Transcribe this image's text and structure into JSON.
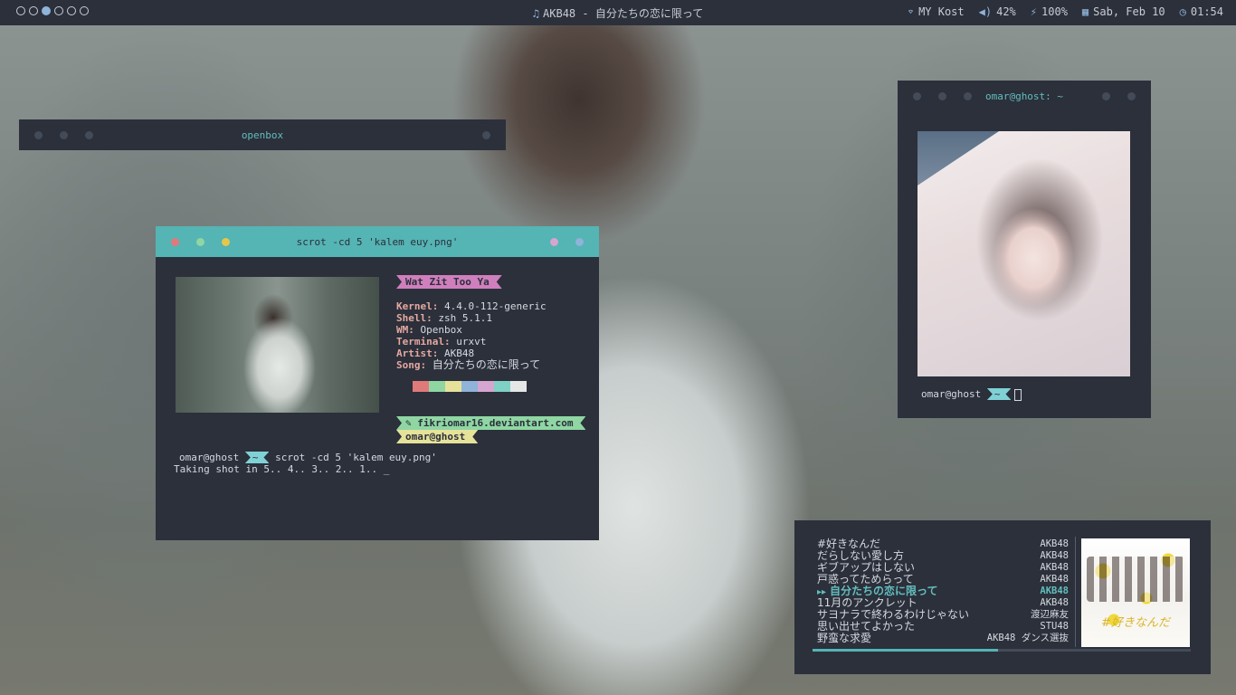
{
  "topbar": {
    "workspaces": 6,
    "active_workspace": 3,
    "now_playing": "AKB48 - 自分たちの恋に限って",
    "wifi": "MY Kost",
    "volume": "42%",
    "battery": "100%",
    "date": "Sab, Feb 10",
    "time": "01:54"
  },
  "openbox_window": {
    "title": "openbox"
  },
  "terminal": {
    "title": "scrot -cd 5 'kalem euy.png'",
    "header_tag": "Wat Zit Too Ya",
    "info": [
      {
        "key": "Kernel:",
        "value": "4.4.0-112-generic"
      },
      {
        "key": "Shell:",
        "value": "zsh 5.1.1"
      },
      {
        "key": "WM:",
        "value": "Openbox"
      },
      {
        "key": "Terminal:",
        "value": "urxvt"
      },
      {
        "key": "Artist:",
        "value": "AKB48"
      },
      {
        "key": "Song:",
        "value": "自分たちの恋に限って"
      }
    ],
    "palette": [
      "#e07a7a",
      "#8fd6a3",
      "#e6e29a",
      "#8fb3d9",
      "#d5a6cf",
      "#7fd1c6",
      "#e6e6e6"
    ],
    "link": "fikriomar16.deviantart.com",
    "user_tag": "omar@ghost",
    "prompt_user": "omar@ghost",
    "prompt_dir": "~",
    "command": "scrot -cd 5 'kalem euy.png'",
    "output": "Taking shot in 5.. 4.. 3.. 2.. 1.. _"
  },
  "terminal2": {
    "title": "omar@ghost: ~",
    "prompt_user": "omar@ghost",
    "prompt_dir": "~"
  },
  "player": {
    "tracks": [
      {
        "title": "#好きなんだ",
        "artist": "AKB48"
      },
      {
        "title": "だらしない愛し方",
        "artist": "AKB48"
      },
      {
        "title": "ギブアップはしない",
        "artist": "AKB48"
      },
      {
        "title": "戸惑ってためらって",
        "artist": "AKB48"
      },
      {
        "title": "自分たちの恋に限って",
        "artist": "AKB48",
        "current": true
      },
      {
        "title": "11月のアンクレット",
        "artist": "AKB48"
      },
      {
        "title": "サヨナラで終わるわけじゃない",
        "artist": "渡辺麻友"
      },
      {
        "title": "思い出せてよかった",
        "artist": "STU48"
      },
      {
        "title": "野蛮な求愛",
        "artist": "AKB48 ダンス選抜"
      }
    ],
    "progress": 0.49,
    "album_title": "#好きなんだ"
  },
  "colors": {
    "accent": "#55b4b4",
    "panel": "#2b303b"
  }
}
